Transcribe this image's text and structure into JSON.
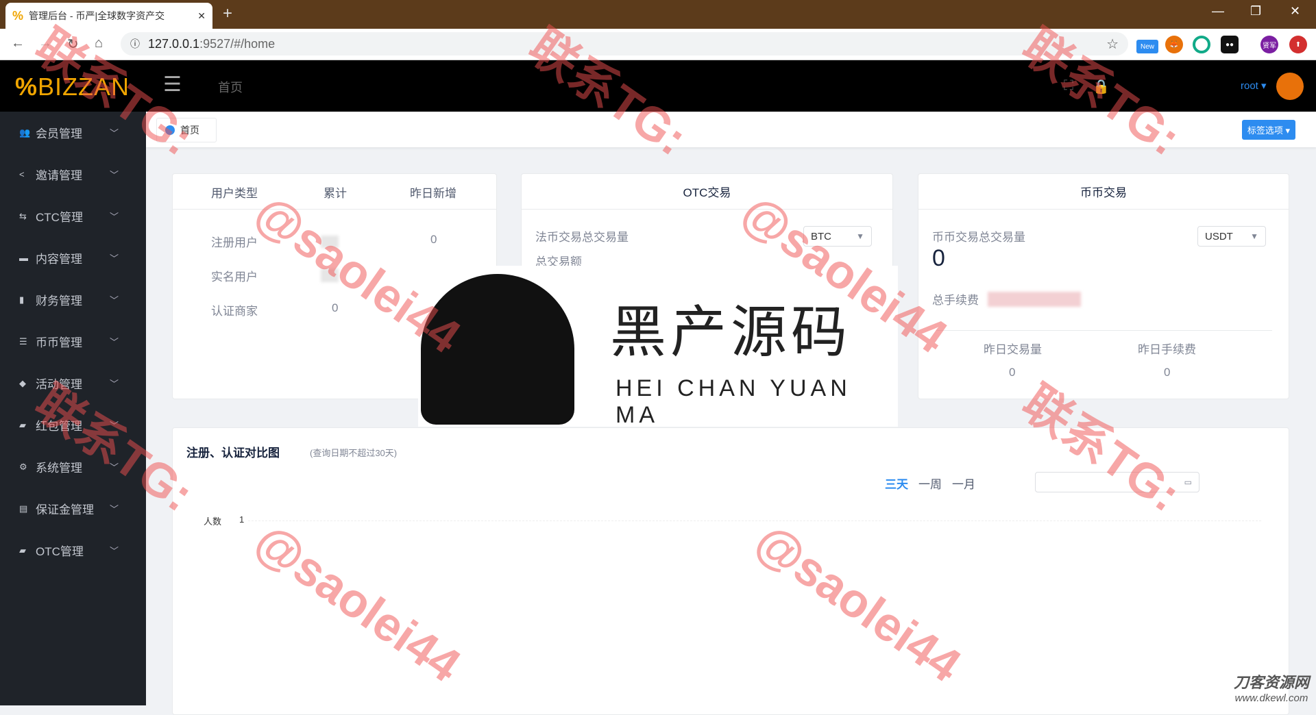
{
  "browser": {
    "tab_title": "管理后台 - 币严|全球数字资产交",
    "url_host": "127.0.0.1",
    "url_rest": ":9527/#/home",
    "ext_new": "New",
    "ext_profile": "贤军"
  },
  "header": {
    "logo": "BIZZAN",
    "home": "首页",
    "user": "root"
  },
  "sidebar": {
    "items": [
      {
        "label": "会员管理",
        "icon": "users-icon",
        "glyph": "👥"
      },
      {
        "label": "邀请管理",
        "icon": "share-icon",
        "glyph": "<"
      },
      {
        "label": "CTC管理",
        "icon": "swap-icon",
        "glyph": "⇆"
      },
      {
        "label": "内容管理",
        "icon": "folder-icon",
        "glyph": "▬"
      },
      {
        "label": "财务管理",
        "icon": "bar-chart-icon",
        "glyph": "▮"
      },
      {
        "label": "币币管理",
        "icon": "sliders-icon",
        "glyph": "☰"
      },
      {
        "label": "活动管理",
        "icon": "cube-icon",
        "glyph": "◆"
      },
      {
        "label": "红包管理",
        "icon": "wallet-icon",
        "glyph": "▰"
      },
      {
        "label": "系统管理",
        "icon": "gear-icon",
        "glyph": "⚙"
      },
      {
        "label": "保证金管理",
        "icon": "money-icon",
        "glyph": "▤"
      },
      {
        "label": "OTC管理",
        "icon": "briefcase-icon",
        "glyph": "▰"
      }
    ]
  },
  "tags": {
    "home": "首页",
    "options": "标签选项"
  },
  "users_card": {
    "headers": [
      "用户类型",
      "累计",
      "昨日新增"
    ],
    "rows": [
      {
        "type": "注册用户",
        "total": "",
        "yesterday": "0"
      },
      {
        "type": "实名用户",
        "total": "",
        "yesterday": ""
      },
      {
        "type": "认证商家",
        "total": "0",
        "yesterday": ""
      }
    ]
  },
  "otc_card": {
    "title": "OTC交易",
    "total_volume_label": "法币交易总交易量",
    "coin": "BTC",
    "total_amount_label": "总交易额"
  },
  "coin_card": {
    "title": "币币交易",
    "total_volume_label": "币币交易总交易量",
    "coin": "USDT",
    "total_volume": "0",
    "total_fee_label": "总手续费",
    "yesterday_volume_label": "昨日交易量",
    "yesterday_volume": "0",
    "yesterday_fee_label": "昨日手续费",
    "yesterday_fee": "0"
  },
  "chart_card": {
    "title": "注册、认证对比图",
    "note": "(查询日期不超过30天)",
    "ranges": [
      "三天",
      "一周",
      "一月"
    ],
    "active_range": "三天",
    "y_label": "人数",
    "y_tick": "1"
  },
  "watermark": {
    "logo_cn": "黑产源码",
    "logo_en": "HEI CHAN YUAN MA",
    "site_cn": "刀客资源网",
    "site_url": "www.dkewl.com",
    "overlay": [
      "联系TG:",
      "@saolei44"
    ]
  },
  "colors": {
    "accent": "#2d8cf0",
    "brand": "#f0a500",
    "sidebar": "#1f2329"
  }
}
